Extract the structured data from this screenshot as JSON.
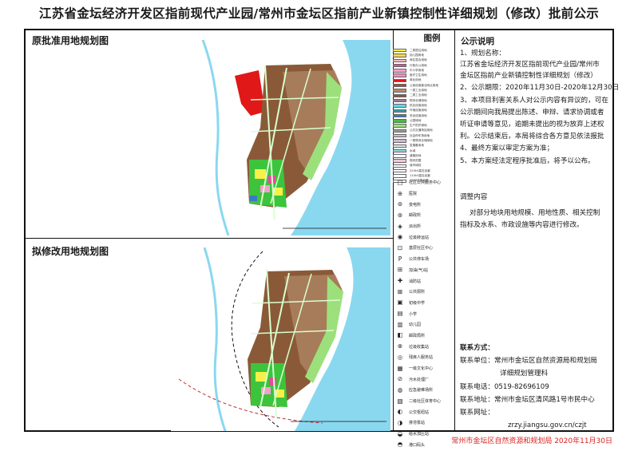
{
  "title": "江苏省金坛经济开发区指前现代产业园/常州市金坛区指前产业新镇控制性详细规划（修改）批前公示",
  "panels": {
    "original_title": "原批准用地规划图",
    "revised_title": "拟修改用地规划图"
  },
  "legend": {
    "title": "图例",
    "landuse": [
      {
        "label": "二类居住用地",
        "color": "#f7f04a"
      },
      {
        "label": "幼儿园用地",
        "color": "#f2d64c"
      },
      {
        "label": "商住混合用地",
        "color": "#f5b8c8"
      },
      {
        "label": "行政办公用地",
        "color": "#e84a9c"
      },
      {
        "label": "中小学用地",
        "color": "#f59fd0"
      },
      {
        "label": "医疗卫生用地",
        "color": "#f08ec0"
      },
      {
        "label": "商业用地",
        "color": "#e01818"
      },
      {
        "label": "公用设施营业网点用地",
        "color": "#c73a3a"
      },
      {
        "label": "一类工业用地",
        "color": "#b48a6a"
      },
      {
        "label": "二类工业用地",
        "color": "#8a5a38"
      },
      {
        "label": "物流仓储用地",
        "color": "#a07a9a"
      },
      {
        "label": "供应设施用地",
        "color": "#6ad2e6"
      },
      {
        "label": "环境设施用地",
        "color": "#2aa4a4"
      },
      {
        "label": "安全设施用地",
        "color": "#3a7ac4"
      },
      {
        "label": "公园绿地",
        "color": "#3cc43c"
      },
      {
        "label": "生产防护绿地",
        "color": "#9ce07c"
      },
      {
        "label": "公共交通场站用地",
        "color": "#9c9c9c"
      },
      {
        "label": "社会停车场用地",
        "color": "#c4c4c4"
      },
      {
        "label": "一般物流仓储用地",
        "color": "#d4b4d8"
      },
      {
        "label": "发展备用地",
        "color": "#e6e6e6"
      },
      {
        "label": "水域",
        "color": "#8ad8f0"
      },
      {
        "label": "道路用地",
        "color": "#ffffff"
      },
      {
        "label": "规划范围",
        "color": "#f4c4d8"
      },
      {
        "label": "城市绿线",
        "color": "#ffffff"
      },
      {
        "label": "220kV高压走廊",
        "color": "#ffffff"
      },
      {
        "label": "110kV高压走廊",
        "color": "#ffffff"
      },
      {
        "label": "35kV线路走廊",
        "color": "#ffffff"
      }
    ],
    "facilities": [
      {
        "icon": "□",
        "label": "社区公共服务中心"
      },
      {
        "icon": "⊕",
        "label": "医院"
      },
      {
        "icon": "⊚",
        "label": "变电所"
      },
      {
        "icon": "⊛",
        "label": "邮政所"
      },
      {
        "icon": "◈",
        "label": "派出所"
      },
      {
        "icon": "◉",
        "label": "垃圾转运站"
      },
      {
        "icon": "⊡",
        "label": "基层社区中心"
      },
      {
        "icon": "P",
        "label": "公共停车场"
      },
      {
        "icon": "⊞",
        "label": "加油(气)站"
      },
      {
        "icon": "✚",
        "label": "消防站"
      },
      {
        "icon": "⊠",
        "label": "公共厕所"
      },
      {
        "icon": "▣",
        "label": "初级中学"
      },
      {
        "icon": "▤",
        "label": "小学"
      },
      {
        "icon": "▥",
        "label": "幼儿园"
      },
      {
        "icon": "◧",
        "label": "邮政局所"
      },
      {
        "icon": "⊗",
        "label": "垃圾收集站"
      },
      {
        "icon": "◎",
        "label": "残疾人服务站"
      },
      {
        "icon": "▦",
        "label": "一级文化中心"
      },
      {
        "icon": "⊘",
        "label": "污水处理厂"
      },
      {
        "icon": "◍",
        "label": "应急避难场所"
      },
      {
        "icon": "▧",
        "label": "二级社区体育中心"
      },
      {
        "icon": "◐",
        "label": "公交枢纽站"
      },
      {
        "icon": "◑",
        "label": "排涝泵站"
      },
      {
        "icon": "◒",
        "label": "给水加压站"
      },
      {
        "icon": "◓",
        "label": "港口码头"
      }
    ]
  },
  "notice": {
    "heading": "公示说明",
    "items": [
      "1、规划名称：",
      "江苏省金坛经济开发区指前现代产业园/常州市",
      "金坛区指前产业新镇控制性详细规划（修改）",
      "2、公示期限：2020年11月30日-2020年12月30日",
      "3、本项目利害关系人对公示内容有异议的，可在",
      "公示期间向我局提出陈述、申辩、请求协调或者",
      "听证申请等意见，逾期未提出的视为放弃上述权",
      "利。公示结束后，本局将综合各方意见依法报批",
      "4、最终方案以审定方案为准；",
      "5、本方案经法定程序批准后，将予以公布。"
    ],
    "adjust_heading": "调整内容",
    "adjust_lines": [
      "对部分地块用地规模、用地性质、相关控制",
      "指标及水系、市政设施等内容进行修改。"
    ],
    "contact_heading": "联系方式：",
    "contact_lines": [
      "联系单位：常州市金坛区自然资源局和规划局",
      "详细规划管理科",
      "联系电话：0519-82696109",
      "联系地址：常州市金坛区清风路1号市民中心",
      "联系网址："
    ],
    "website": "zrzy.jiangsu.gov.cn/czjt"
  },
  "footer": "常州市金坛区自然资源和规划局 2020年11月30日",
  "colors": {
    "water": "#8ad8f0",
    "green": "#3cc43c",
    "industry": "#8a5a38",
    "residential": "#f7f04a",
    "commercial": "#e01818",
    "footer_red": "#d8231f"
  }
}
